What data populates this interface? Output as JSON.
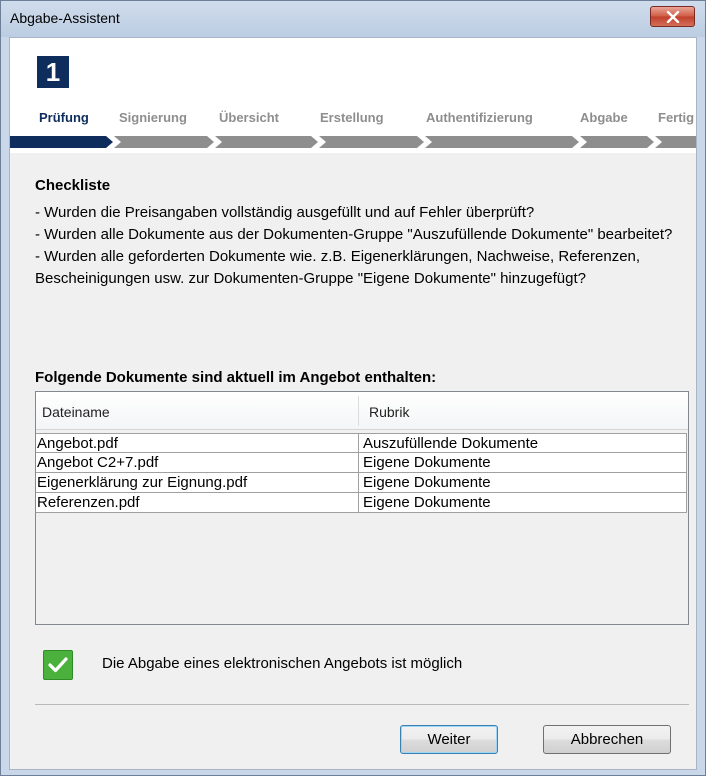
{
  "window": {
    "title": "Abgabe-Assistent"
  },
  "wizard": {
    "current_step_number": "1",
    "steps": [
      {
        "label": "Prüfung",
        "active": true
      },
      {
        "label": "Signierung",
        "active": false
      },
      {
        "label": "Übersicht",
        "active": false
      },
      {
        "label": "Erstellung",
        "active": false
      },
      {
        "label": "Authentifizierung",
        "active": false
      },
      {
        "label": "Abgabe",
        "active": false
      },
      {
        "label": "Fertig",
        "active": false
      }
    ]
  },
  "checklist": {
    "title": "Checkliste",
    "items": [
      "- Wurden die Preisangaben vollständig ausgefüllt und auf Fehler überprüft?",
      "- Wurden alle Dokumente aus der Dokumenten-Gruppe \"Auszufüllende Dokumente\" bearbeitet?",
      "- Wurden alle geforderten Dokumente wie. z.B. Eigenerklärungen, Nachweise, Referenzen, Bescheinigungen usw. zur Dokumenten-Gruppe \"Eigene Dokumente\" hinzugefügt?"
    ]
  },
  "documents": {
    "title": "Folgende Dokumente sind aktuell im Angebot enthalten:",
    "columns": [
      "Dateiname",
      "Rubrik"
    ],
    "rows": [
      [
        "Angebot.pdf",
        "Auszufüllende Dokumente"
      ],
      [
        "Angebot C2+7.pdf",
        "Eigene Dokumente"
      ],
      [
        "Eigenerklärung zur Eignung.pdf",
        "Eigene Dokumente"
      ],
      [
        "Referenzen.pdf",
        "Eigene Dokumente"
      ]
    ]
  },
  "status": {
    "icon": "check-icon",
    "text": "Die Abgabe eines elektronischen Angebots ist möglich"
  },
  "buttons": {
    "next": "Weiter",
    "cancel": "Abbrechen"
  },
  "colors": {
    "accent": "#0e2d5c",
    "inactive_step": "#8e8e8e",
    "success": "#4ab23c",
    "close": "#c1402b"
  }
}
